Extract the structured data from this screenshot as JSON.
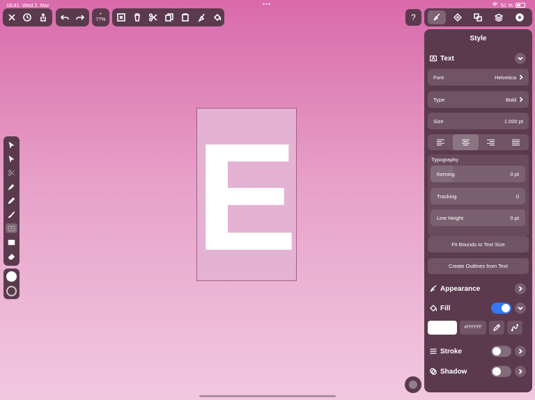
{
  "status": {
    "time": "18:41",
    "date": "Wed 2. Mar",
    "battery": "51 %"
  },
  "toolbar": {
    "zoom": "77%"
  },
  "canvas": {
    "text": "E"
  },
  "help": {
    "label": "?"
  },
  "panel": {
    "title": "Style",
    "text_section": {
      "title": "Text",
      "font_label": "Font",
      "font_value": "Helvetica",
      "type_label": "Type",
      "type_value": "Bold",
      "size_label": "Size",
      "size_value": "1.000 pt",
      "alignment_selected": "center"
    },
    "typography": {
      "title": "Typography",
      "kerning_label": "Kerning",
      "kerning_value": "0 pt",
      "tracking_label": "Tracking",
      "tracking_value": "0",
      "line_height_label": "Line Height",
      "line_height_value": "0 pt"
    },
    "fit_bounds_label": "Fit Bounds to Text Size",
    "create_outlines_label": "Create Outlines from Text",
    "appearance": {
      "title": "Appearance"
    },
    "fill": {
      "title": "Fill",
      "enabled": true,
      "color": "#FFFFFF",
      "hex_label": "#FFFFFF"
    },
    "stroke": {
      "title": "Stroke",
      "enabled": false
    },
    "shadow": {
      "title": "Shadow",
      "enabled": false
    }
  },
  "colors": {
    "accent": "#3478f6",
    "panel": "#5b3a4e"
  }
}
